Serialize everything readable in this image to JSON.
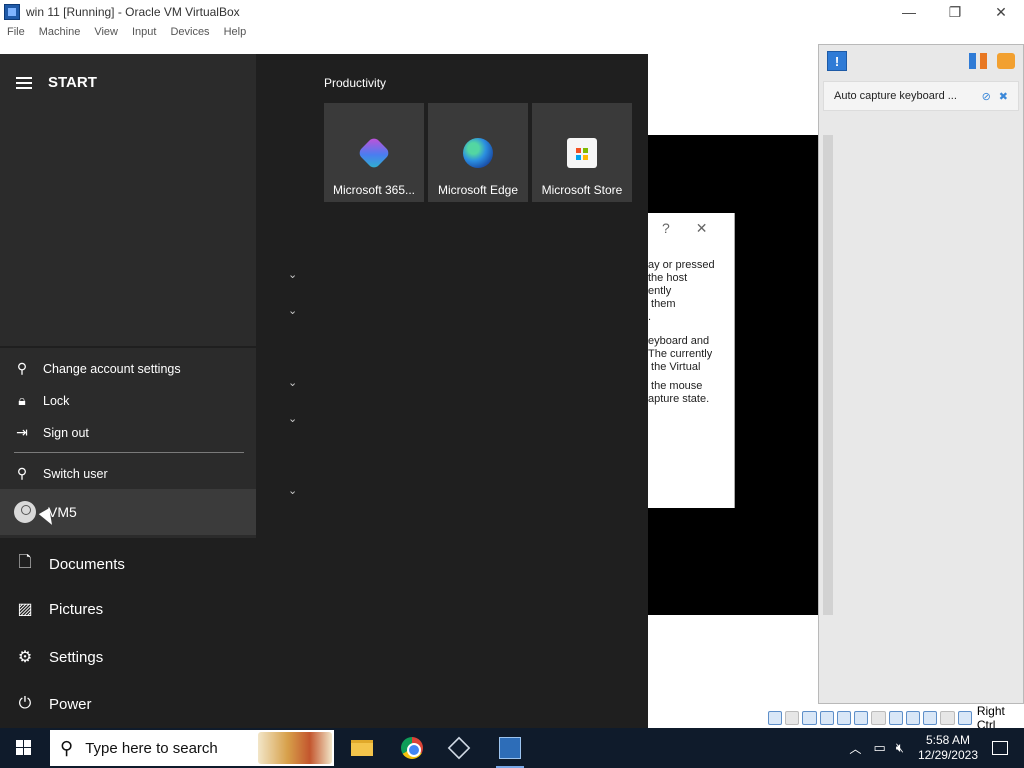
{
  "host": {
    "title": "win 11 [Running] - Oracle VM VirtualBox",
    "menu": [
      "File",
      "Machine",
      "View",
      "Input",
      "Devices",
      "Help"
    ],
    "window_controls": [
      "minimize",
      "restore",
      "close"
    ]
  },
  "side_panel": {
    "message": "Auto capture keyboard ...",
    "icons": [
      "info-icon",
      "settings-icon",
      "snapshot-icon"
    ]
  },
  "dialog": {
    "help": "?",
    "close": "✕",
    "para1": "ay or pressed\nthe host\nently\n them\n.",
    "para2": "eyboard and\nThe currently\n the Virtual",
    "para3": " the mouse\napture state."
  },
  "statusbar": {
    "host_key": "Right Ctrl"
  },
  "start_menu": {
    "header": "START",
    "account_menu": {
      "change_account": "Change account settings",
      "lock": "Lock",
      "sign_out": "Sign out",
      "switch_user": "Switch user"
    },
    "user": "VM5",
    "items": [
      "Documents",
      "Pictures",
      "Settings",
      "Power"
    ],
    "group_label": "Productivity",
    "tiles": [
      "Microsoft 365...",
      "Microsoft Edge",
      "Microsoft Store"
    ]
  },
  "taskbar": {
    "search_placeholder": "Type here to search",
    "time": "5:58 AM",
    "date": "12/29/2023"
  }
}
